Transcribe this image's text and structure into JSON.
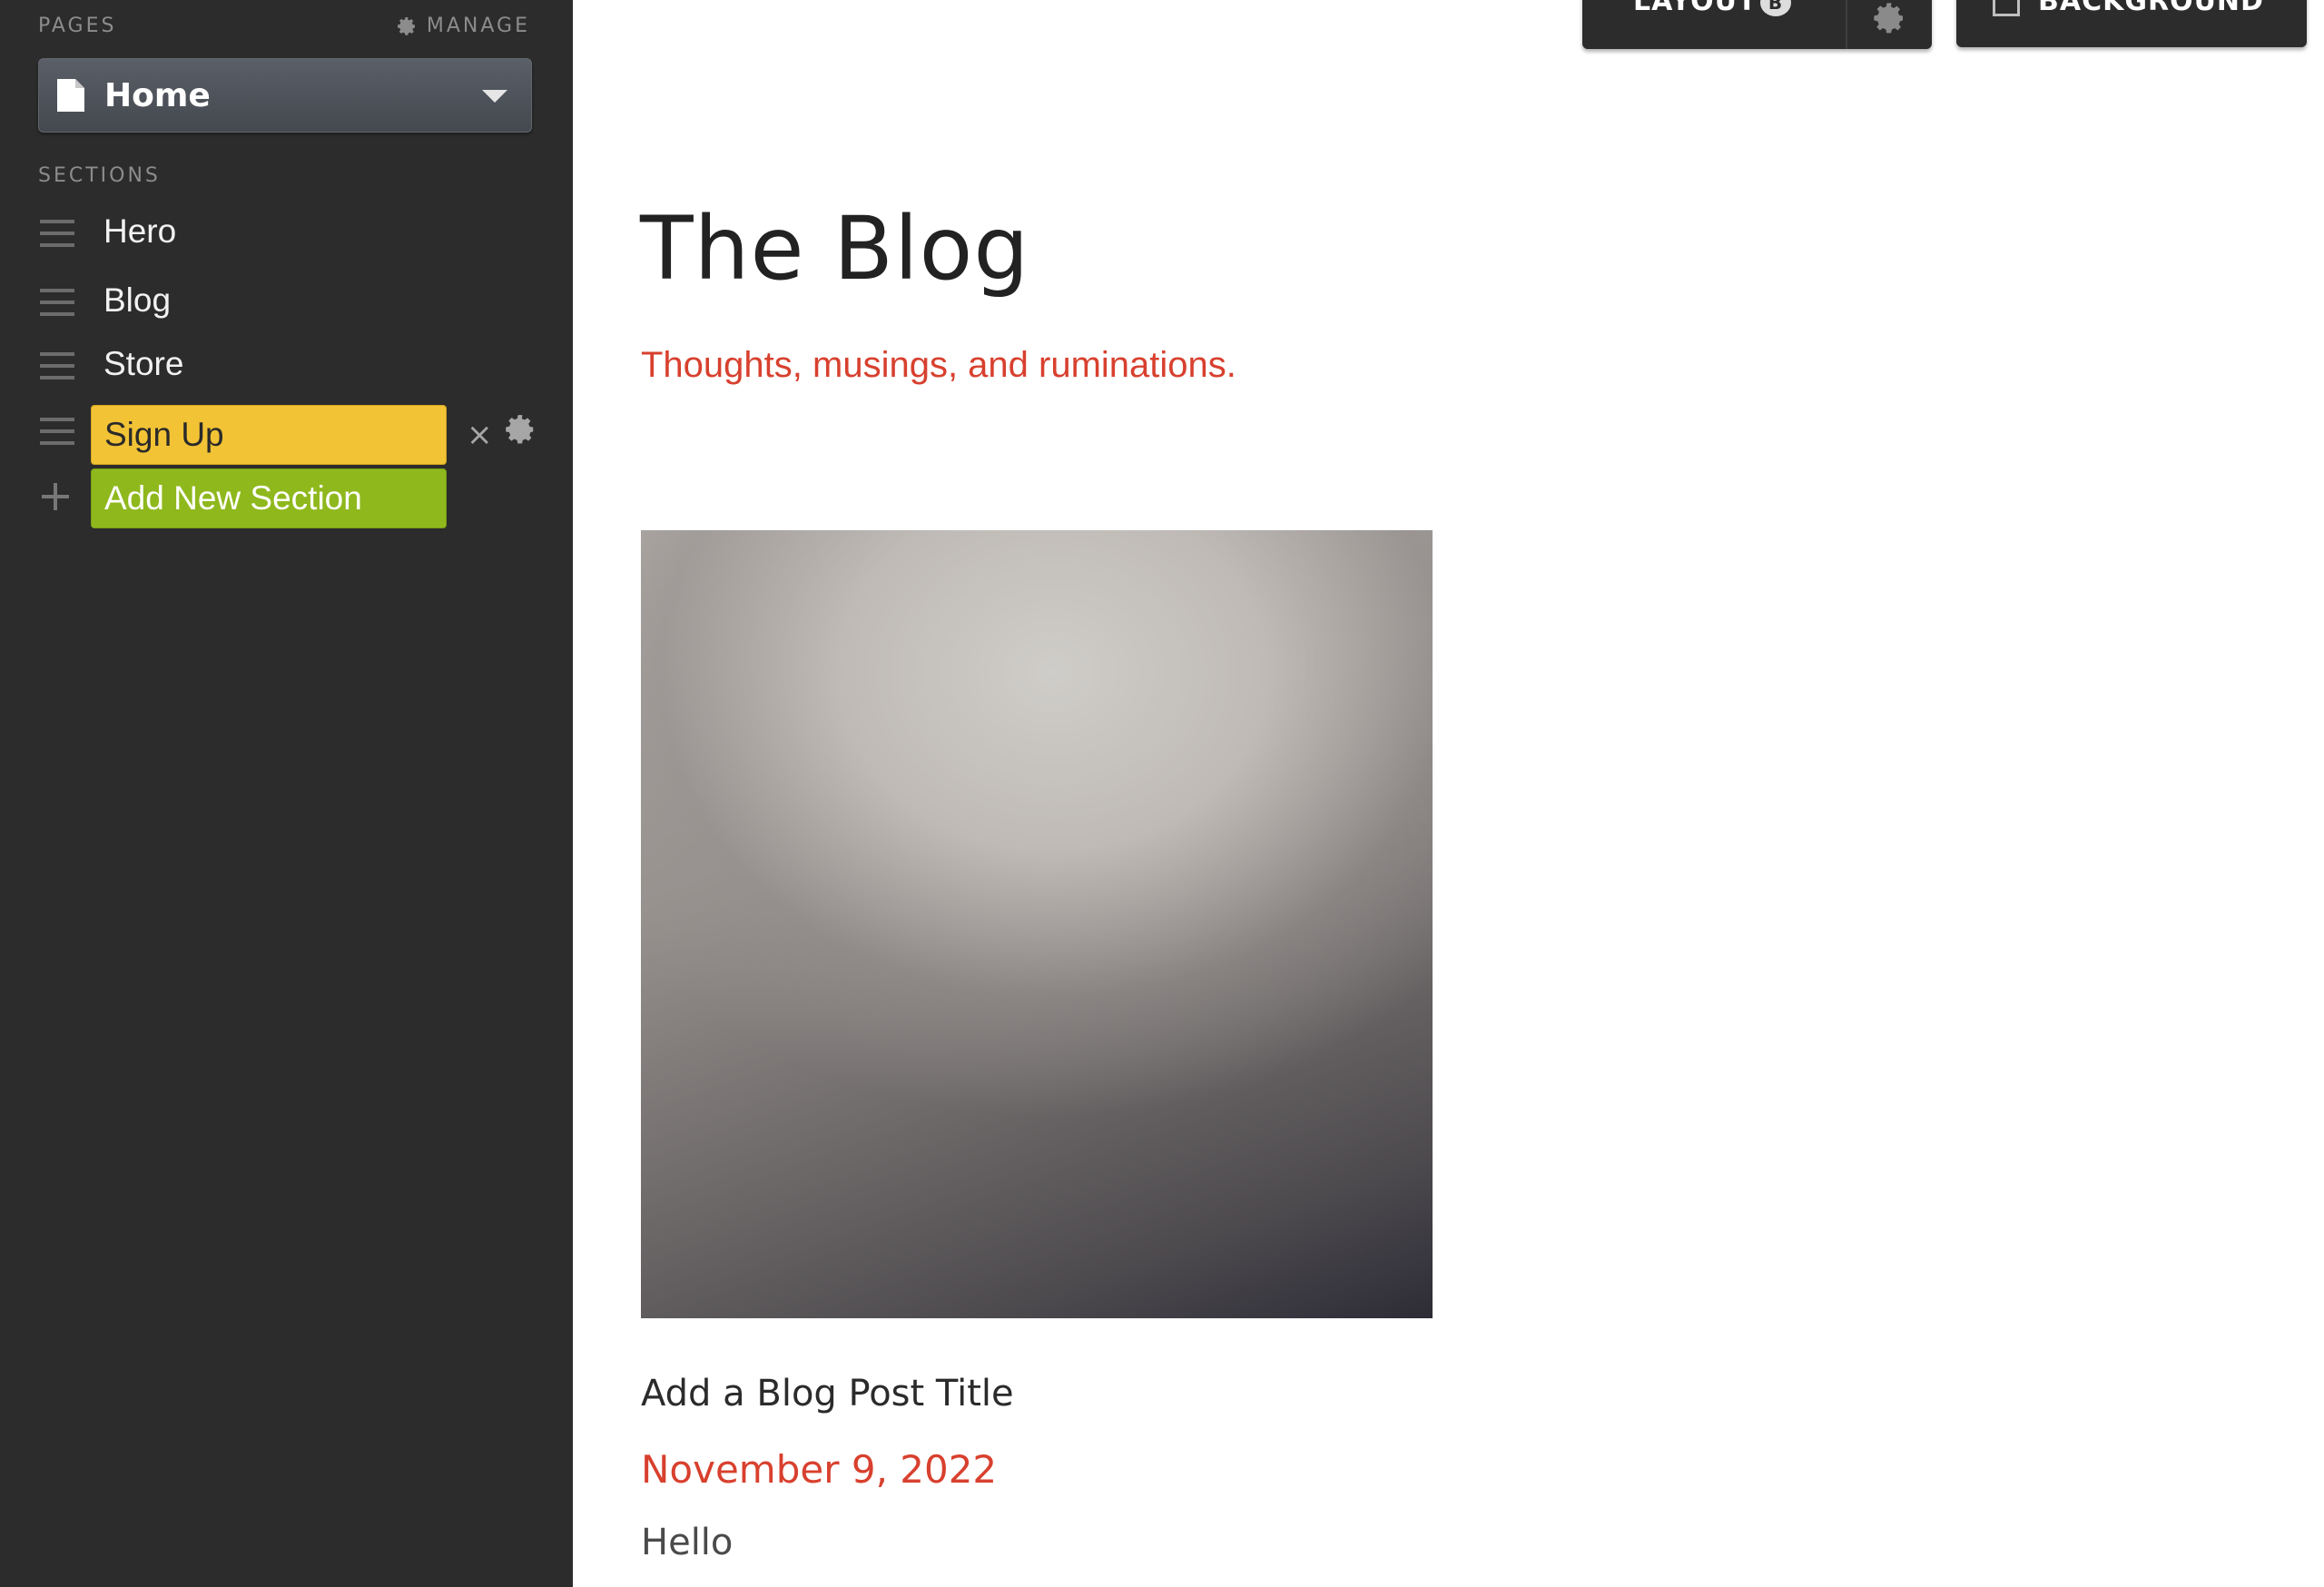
{
  "sidebar": {
    "pages_caption": "PAGES",
    "manage_label": "MANAGE",
    "page_select_value": "Home",
    "sections_caption": "SECTIONS",
    "sections": [
      {
        "label": "Hero"
      },
      {
        "label": "Blog"
      },
      {
        "label": "Store"
      },
      {
        "label": "Sign Up",
        "highlight_color": "#f2c335"
      }
    ],
    "add_section_label": "Add New Section",
    "add_section_color": "#8fb81d",
    "close_glyph": "×"
  },
  "toolbar": {
    "layout_label": "LAYOUT",
    "layout_badge": "B",
    "background_label": "BACKGROUND"
  },
  "blog": {
    "title": "The Blog",
    "subtitle": "Thoughts, musings, and ruminations.",
    "accent_color": "#d8402e",
    "post": {
      "title": "Add a Blog Post Title",
      "date": "November 9, 2022",
      "excerpt": "Hello"
    }
  },
  "icons": [
    "gear-icon",
    "document-icon",
    "chevron-down-icon",
    "drag-handle-icon",
    "close-icon",
    "plus-icon",
    "image-icon"
  ]
}
